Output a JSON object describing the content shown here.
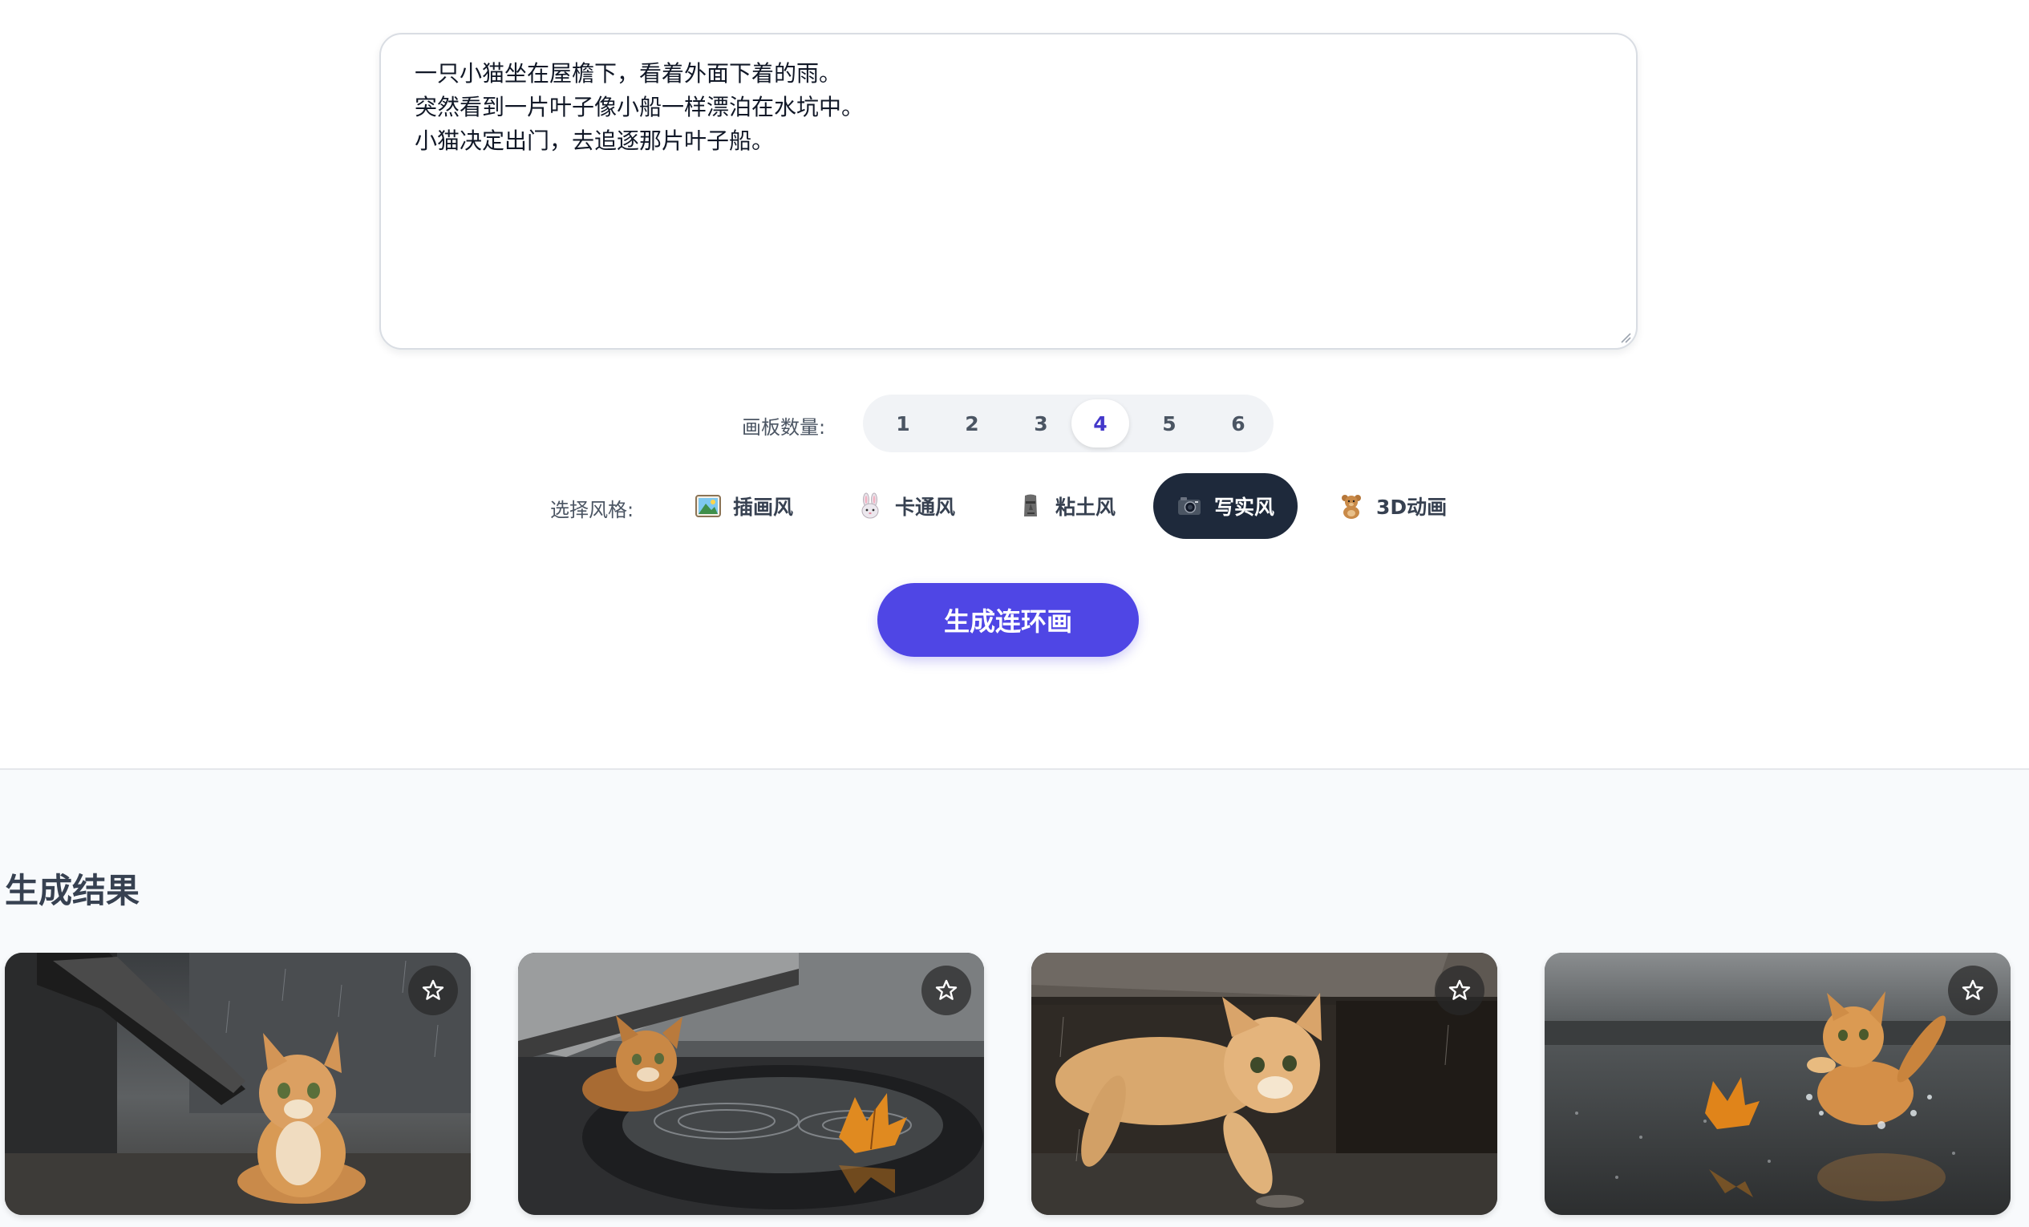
{
  "story": {
    "text": "一只小猫坐在屋檐下，看着外面下着的雨。\n突然看到一片叶子像小船一样漂泊在水坑中。\n小猫决定出门，去追逐那片叶子船。"
  },
  "panel_count": {
    "label": "画板数量:",
    "options": [
      "1",
      "2",
      "3",
      "4",
      "5",
      "6"
    ],
    "selected": "4"
  },
  "style": {
    "label": "选择风格:",
    "options": [
      {
        "icon": "landscape-picture-icon",
        "label": "插画风"
      },
      {
        "icon": "rabbit-face-icon",
        "label": "卡通风"
      },
      {
        "icon": "moai-statue-icon",
        "label": "粘土风"
      },
      {
        "icon": "camera-icon",
        "label": "写实风"
      },
      {
        "icon": "teddy-bear-icon",
        "label": "3D动画"
      }
    ],
    "selected": "写实风"
  },
  "generate_label": "生成连环画",
  "results": {
    "title": "生成结果",
    "panels": [
      {
        "image": "kitten sitting under an eave watching the rain",
        "favorite_icon": "star-outline-icon"
      },
      {
        "image": "kitten peeking from under a ledge at a leaf floating in a puddle",
        "favorite_icon": "star-outline-icon"
      },
      {
        "image": "kitten stepping out from under the ledge into the rain",
        "favorite_icon": "star-outline-icon"
      },
      {
        "image": "kitten leaping through water chasing the leaf",
        "favorite_icon": "star-outline-icon"
      }
    ]
  },
  "colors": {
    "accent": "#4f46e5",
    "selected_style_bg": "#1e293b",
    "results_bg": "#f8fafc"
  }
}
